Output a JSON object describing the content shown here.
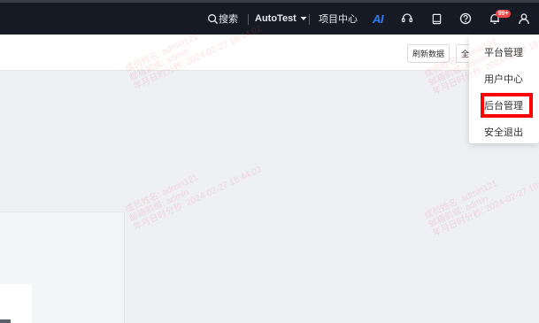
{
  "nav": {
    "search_label": "搜索",
    "project_name": "AutoTest",
    "project_center": "项目中心",
    "ai_label": "AI",
    "notification_count": "99+"
  },
  "toolbar": {
    "refresh_label": "刷新数据",
    "all_label": "全"
  },
  "user_menu": {
    "items": [
      "平台管理",
      "用户中心",
      "后台管理",
      "安全退出"
    ]
  },
  "watermark": {
    "lines": [
      "成员姓名: admin121",
      "邮箱前缀: admin",
      "年月日时分秒: 2024-02-27 18:44:02"
    ]
  },
  "colors": {
    "navbar_bg": "#151a24",
    "ai_accent": "#2f7cf6",
    "badge": "#f04848",
    "highlight": "#ff0000"
  }
}
